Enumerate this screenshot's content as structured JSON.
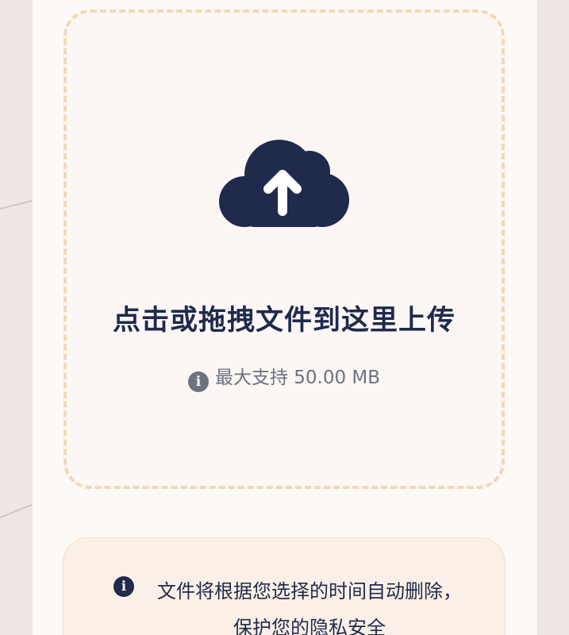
{
  "upload": {
    "title": "点击或拖拽文件到这里上传",
    "size_limit": "最大支持 50.00 MB",
    "icon": "cloud-upload-icon"
  },
  "notice": {
    "text": "文件将根据您选择的时间自动删除，保护您的隐私安全",
    "icon": "info-icon"
  },
  "colors": {
    "primary": "#1f2a4c",
    "dashed_border": "#f3d8b3",
    "muted_text": "#6b7280",
    "notice_bg": "#fbf0e7"
  }
}
